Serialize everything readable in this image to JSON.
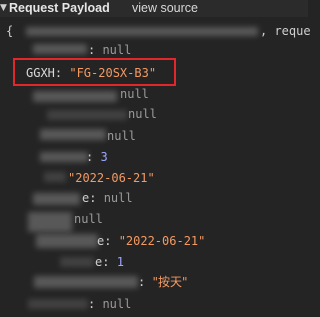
{
  "header": {
    "title": "Request Payload",
    "view_source": "view source"
  },
  "lines": {
    "l1": {
      "prefix": "{",
      "suffix": ", reque"
    },
    "l2": {
      "tail": ": ",
      "value": "null"
    },
    "l3": {
      "key": "GGXH",
      "colon": ": ",
      "value": "\"FG-20SX-B3\""
    },
    "l4": {
      "value": "null"
    },
    "l5": {
      "value": "null"
    },
    "l6": {
      "value": "null"
    },
    "l7": {
      "tail": ": ",
      "value": "3"
    },
    "l8": {
      "value": "\"2022-06-21\""
    },
    "l9": {
      "tail": "e: ",
      "value": "null"
    },
    "l10": {
      "value": "null"
    },
    "l11": {
      "tail": "e: ",
      "value": "\"2022-06-21\""
    },
    "l12": {
      "tail": "e: ",
      "value": "1"
    },
    "l13": {
      "tail": ": ",
      "value": "\"按天\""
    },
    "l14": {
      "tail": ": ",
      "value": "null"
    }
  }
}
